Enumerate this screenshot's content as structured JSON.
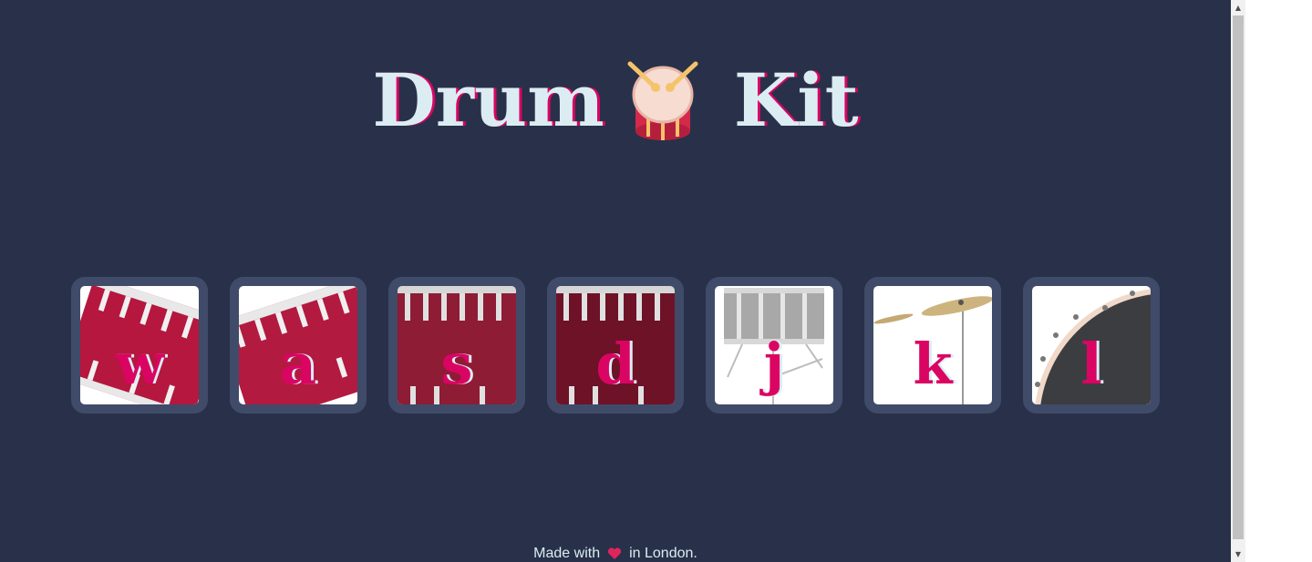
{
  "header": {
    "title_left": "Drum",
    "title_right": "Kit",
    "emoji_icon": "drum-icon"
  },
  "drums": [
    {
      "key": "w",
      "instrument": "tom-1",
      "icon": "tom-drum-icon"
    },
    {
      "key": "a",
      "instrument": "tom-2",
      "icon": "tom-drum-icon"
    },
    {
      "key": "s",
      "instrument": "tom-3",
      "icon": "floor-tom-icon"
    },
    {
      "key": "d",
      "instrument": "tom-4",
      "icon": "floor-tom-icon"
    },
    {
      "key": "j",
      "instrument": "snare",
      "icon": "snare-drum-icon"
    },
    {
      "key": "k",
      "instrument": "crash",
      "icon": "cymbal-icon"
    },
    {
      "key": "l",
      "instrument": "kick-bass",
      "icon": "kick-drum-icon"
    }
  ],
  "footer": {
    "before": "Made with",
    "heart_icon": "heart-icon",
    "after": "in London."
  },
  "colors": {
    "background": "#283149",
    "drum_border": "#404b69",
    "accent": "#da0463",
    "text": "#dbedf3"
  }
}
